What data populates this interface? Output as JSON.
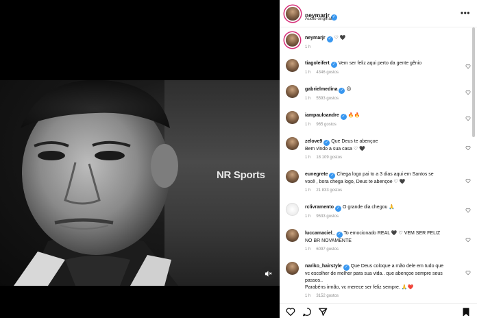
{
  "video": {
    "watermark": "NR Sports"
  },
  "post": {
    "username": "neymarjr",
    "audio": "Áudio original"
  },
  "caption": {
    "username": "neymarjr",
    "text": "♡ 🖤",
    "time": "1 h"
  },
  "comments": [
    {
      "username": "tiagoleifert",
      "text": "Vem ser feliz aqui perto da gente gênio",
      "time": "1 h",
      "likes": "4346 gostos"
    },
    {
      "username": "gabrielmedina",
      "text": "😍",
      "time": "1 h",
      "likes": "5593 gostos"
    },
    {
      "username": "iampauloandre",
      "text": "🔥🔥",
      "time": "1 h",
      "likes": "965 gostos"
    },
    {
      "username": "zelove9",
      "text": "Que Deus te abençoe",
      "text2": "Bem vindo a sua casa ♡ 🖤",
      "time": "1 h",
      "likes": "18 109 gostos"
    },
    {
      "username": "eunegrete",
      "text": "Chega logo pai to a 3 dias aqui em Santos se",
      "text2": "você , bora chega logo, Deus te abençoe ♡ 🖤",
      "time": "1 h",
      "likes": "21 833 gostos"
    },
    {
      "username": "rclivramento",
      "text": "O grande dia chegou 🙏",
      "time": "1 h",
      "likes": "9533 gostos"
    },
    {
      "username": "luccamaciel_",
      "text": "To emocionado REAL 🖤 ♡ VEM SER FELIZ",
      "text2": "NO BR NOVAMENTE",
      "time": "1 h",
      "likes": "6097 gostos"
    },
    {
      "username": "nariko_hairstyle",
      "text": "Que Deus coloque a mão dele em tudo que",
      "text2": "vc escolher de melhor para sua vida.. que abençoe sempre seus",
      "text3": "passos..",
      "text4": "Parabéns irmão, vc merece ser feliz sempre. 🙏❤️",
      "time": "1 h",
      "likes": "3152 gostos"
    }
  ]
}
